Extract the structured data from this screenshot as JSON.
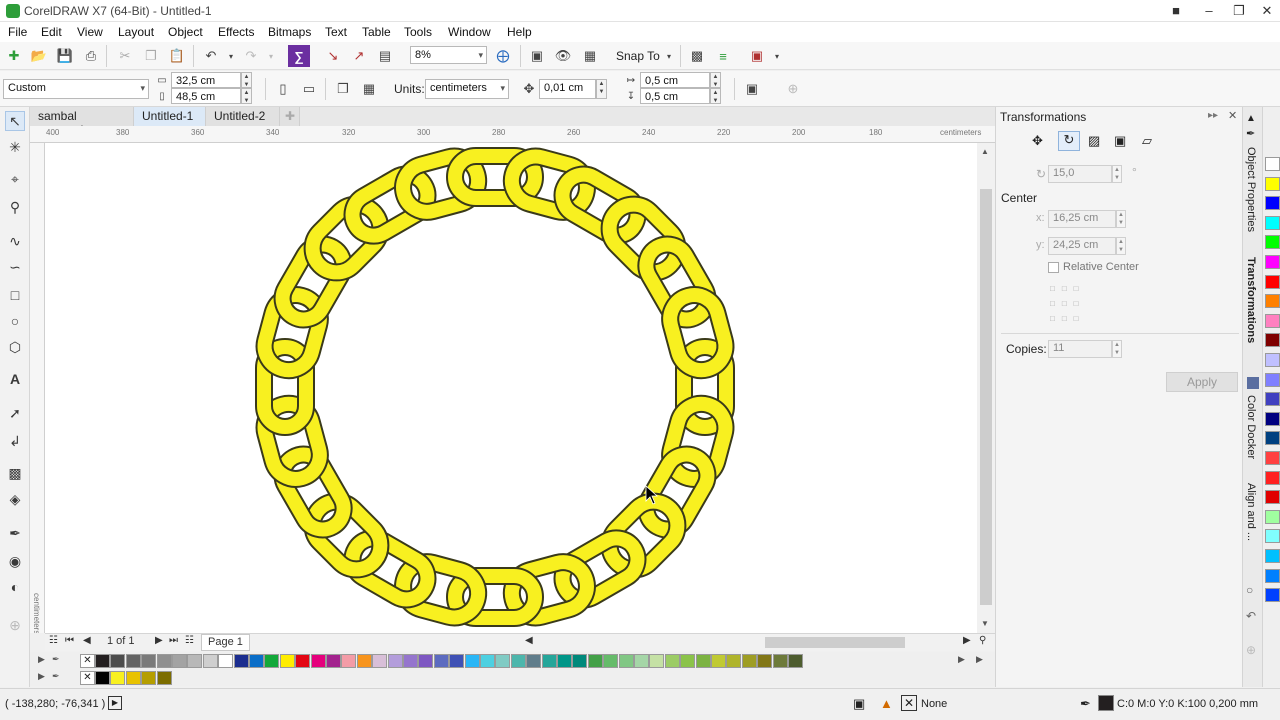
{
  "window": {
    "title": "CorelDRAW X7 (64-Bit) - Untitled-1"
  },
  "menu": [
    "File",
    "Edit",
    "View",
    "Layout",
    "Object",
    "Effects",
    "Bitmaps",
    "Text",
    "Table",
    "Tools",
    "Window",
    "Help"
  ],
  "toolbar": {
    "zoom": "8%",
    "snap_to": "Snap To"
  },
  "property_bar": {
    "page_size": "Custom",
    "width": "32,5 cm",
    "height": "48,5 cm",
    "units_label": "Units:",
    "units": "centimeters",
    "nudge": "0,01 cm",
    "dup_x": "0,5 cm",
    "dup_y": "0,5 cm"
  },
  "tabs": [
    {
      "label": "sambal asam.cdr"
    },
    {
      "label": "Untitled-1"
    },
    {
      "label": "Untitled-2"
    }
  ],
  "ruler": {
    "unit": "centimeters",
    "h_ticks": [
      "400",
      "380",
      "360",
      "340",
      "320",
      "300",
      "280",
      "260",
      "240",
      "220",
      "200",
      "180"
    ],
    "v_unit": "centimeters"
  },
  "page_nav": {
    "count": "1 of 1",
    "page_tab": "Page 1"
  },
  "docker": {
    "title": "Transformations",
    "angle": "15,0",
    "angle_unit": "°",
    "center_label": "Center",
    "x_label": "x:",
    "x": "16,25 cm",
    "y_label": "y:",
    "y": "24,25 cm",
    "relative_center": "Relative Center",
    "copies_label": "Copies:",
    "copies": "11",
    "apply": "Apply"
  },
  "docker_tabs": [
    "Object Properties",
    "Transformations",
    "Color Docker",
    "Align and ..."
  ],
  "status": {
    "coords": "( -138,280; -76,341 )",
    "fill": "None",
    "outline": "C:0 M:0 Y:0 K:100  0,200 mm"
  },
  "colors": {
    "chain_fill": "#f8f020",
    "chain_stroke": "#3a3a1a",
    "palette": [
      "#231f20",
      "#4b4b4b",
      "#636363",
      "#7a7a7a",
      "#8f8f8f",
      "#a3a3a3",
      "#b8b8b8",
      "#cfcfcf",
      "#ffffff",
      "#1b2d8f",
      "#0a6ec8",
      "#13a83a",
      "#ffed00",
      "#e30613",
      "#e5007d",
      "#a3238e",
      "#f39ca7",
      "#f7941d",
      "#d8bfd8",
      "#b39ddb",
      "#9575cd",
      "#7e57c2",
      "#5c6bc0",
      "#3f51b5",
      "#29b6f6",
      "#4dd0e1",
      "#80cbc4",
      "#4db6ac",
      "#607d8b",
      "#26a69a",
      "#009688",
      "#00897b",
      "#43a047",
      "#66bb6a",
      "#81c784",
      "#a5d6a7",
      "#c5e1a5",
      "#9ccc65",
      "#8bc34a",
      "#7cb342",
      "#c0ca33",
      "#afb42b",
      "#9e9d24",
      "#827717",
      "#6d7a3a",
      "#4e5d2f"
    ],
    "doc_palette": [
      "#000000",
      "#f8f020",
      "#e8c200",
      "#b59e00",
      "#7c6d00"
    ],
    "strip": [
      "#ffffff",
      "#ffff00",
      "#0000ff",
      "#00ffff",
      "#00ff00",
      "#ff00ff",
      "#ff0000",
      "#ff8000",
      "#ff80c0",
      "#800000",
      "#c0c0ff",
      "#8080ff",
      "#4040c0",
      "#000080",
      "#004080",
      "#ff4040",
      "#ff2020",
      "#e00000",
      "#a0ffa0",
      "#80ffff",
      "#00c0ff",
      "#0080ff",
      "#0040ff"
    ]
  }
}
